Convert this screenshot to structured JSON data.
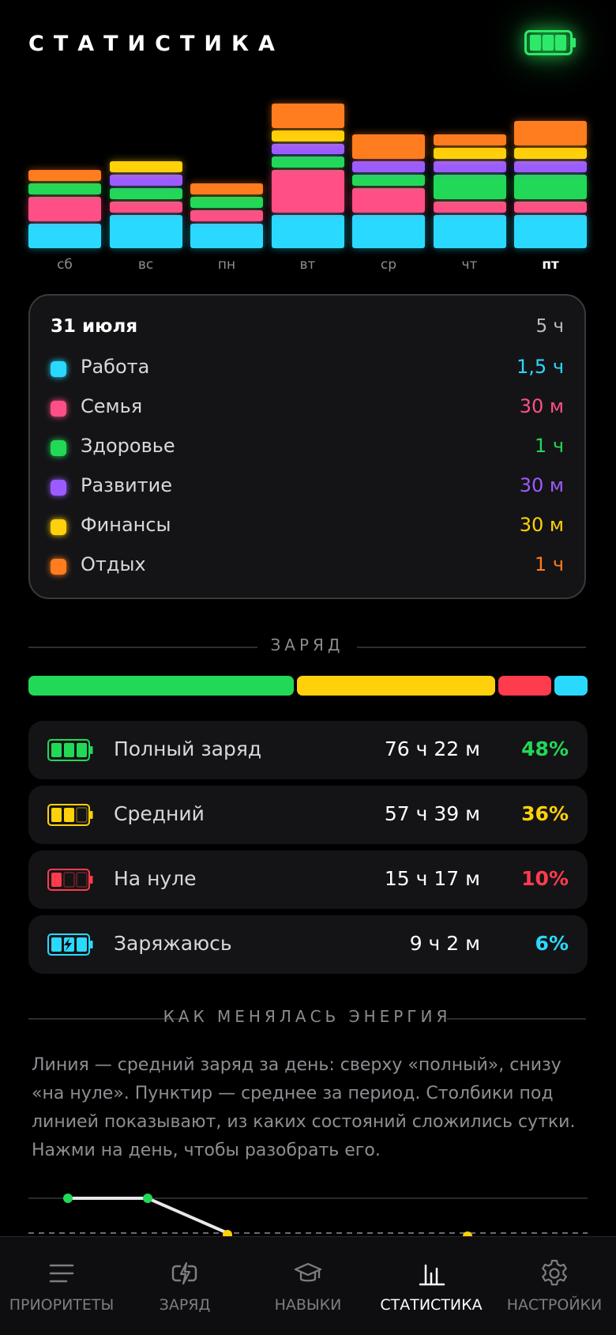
{
  "header": {
    "title": "СТАТИСТИКА",
    "battery_icon": "battery-full-icon"
  },
  "categories": [
    {
      "key": "work",
      "name": "Работа",
      "color": "#2ad9ff"
    },
    {
      "key": "family",
      "name": "Семья",
      "color": "#ff4f86"
    },
    {
      "key": "health",
      "name": "Здоровье",
      "color": "#22d957"
    },
    {
      "key": "growth",
      "name": "Развитие",
      "color": "#9b5cff"
    },
    {
      "key": "finance",
      "name": "Финансы",
      "color": "#ffd10a"
    },
    {
      "key": "rest",
      "name": "Отдых",
      "color": "#ff7c1f"
    }
  ],
  "chart_data": {
    "type": "bar",
    "stacked": true,
    "categories": [
      "сб",
      "вс",
      "пн",
      "вт",
      "ср",
      "чт",
      "пт"
    ],
    "selected_day": "пт",
    "series": [
      {
        "name": "Работа",
        "color": "#2ad9ff",
        "values": [
          1.5,
          2,
          1.5,
          2,
          2,
          2,
          2
        ]
      },
      {
        "name": "Семья",
        "color": "#ff4f86",
        "values": [
          1.5,
          0.75,
          0.75,
          2.5,
          1.5,
          0.75,
          0.75
        ]
      },
      {
        "name": "Здоровье",
        "color": "#22d957",
        "values": [
          0.75,
          0.75,
          0.75,
          0.75,
          0.75,
          1.5,
          1.5
        ]
      },
      {
        "name": "Развитие",
        "color": "#9b5cff",
        "values": [
          0,
          0.75,
          0,
          0.75,
          0.75,
          0.75,
          0.75
        ]
      },
      {
        "name": "Финансы",
        "color": "#ffd10a",
        "values": [
          0,
          0.75,
          0,
          0.75,
          0,
          0.75,
          0.75
        ]
      },
      {
        "name": "Отдых",
        "color": "#ff7c1f",
        "values": [
          0.75,
          0,
          0.75,
          1.5,
          1.5,
          0.75,
          1.5
        ]
      }
    ]
  },
  "day_card": {
    "date": "31 июля",
    "total": "5 ч",
    "rows": [
      {
        "name": "Работа",
        "value": "1,5 ч",
        "color": "#2ad9ff"
      },
      {
        "name": "Семья",
        "value": "30 м",
        "color": "#ff4f86"
      },
      {
        "name": "Здоровье",
        "value": "1 ч",
        "color": "#22d957"
      },
      {
        "name": "Развитие",
        "value": "30 м",
        "color": "#9b5cff"
      },
      {
        "name": "Финансы",
        "value": "30 м",
        "color": "#ffd10a"
      },
      {
        "name": "Отдых",
        "value": "1 ч",
        "color": "#ff7c1f"
      }
    ]
  },
  "charge": {
    "heading": "ЗАРЯД",
    "bar": [
      {
        "state": "full",
        "percent": 48,
        "color": "#22d957"
      },
      {
        "state": "medium",
        "percent": 36,
        "color": "#ffd10a"
      },
      {
        "state": "zero",
        "percent": 10,
        "color": "#ff3b4e"
      },
      {
        "state": "charging",
        "percent": 6,
        "color": "#2ad9ff"
      }
    ],
    "rows": [
      {
        "icon": "battery-full-icon",
        "label": "Полный заряд",
        "time": "76 ч 22 м",
        "percent": "48%",
        "color": "#22d957"
      },
      {
        "icon": "battery-medium-icon",
        "label": "Средний",
        "time": "57 ч 39 м",
        "percent": "36%",
        "color": "#ffd10a"
      },
      {
        "icon": "battery-empty-icon",
        "label": "На нуле",
        "time": "15 ч 17 м",
        "percent": "10%",
        "color": "#ff3b4e"
      },
      {
        "icon": "battery-charging-icon",
        "label": "Заряжаюсь",
        "time": "9 ч 2 м",
        "percent": "6%",
        "color": "#2ad9ff"
      }
    ]
  },
  "energy": {
    "heading": "КАК МЕНЯЛАСЬ ЭНЕРГИЯ",
    "description": "Линия — средний заряд за день: сверху «полный», снизу «на нуле». Пунктир — среднее за период. Столбики под линией показывают, из каких состояний сложились сутки. Нажми на день, чтобы разобрать его."
  },
  "nav": {
    "items": [
      {
        "label": "ПРИОРИТЕТЫ",
        "icon": "list-icon",
        "active": false
      },
      {
        "label": "ЗАРЯД",
        "icon": "charge-icon",
        "active": false
      },
      {
        "label": "НАВЫКИ",
        "icon": "graduation-cap-icon",
        "active": false
      },
      {
        "label": "СТАТИСТИКА",
        "icon": "bar-chart-icon",
        "active": true
      },
      {
        "label": "НАСТРОЙКИ",
        "icon": "gear-icon",
        "active": false
      }
    ]
  }
}
